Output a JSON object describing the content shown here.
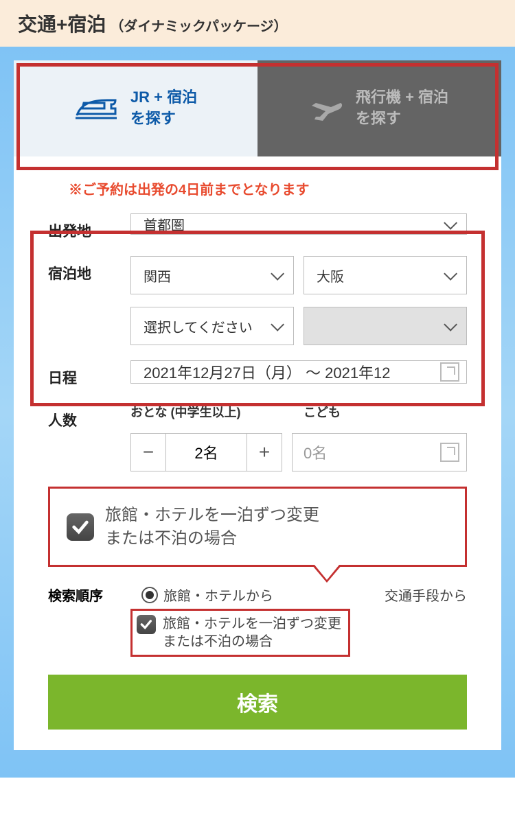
{
  "header": {
    "title": "交通+宿泊",
    "subtitle": "（ダイナミックパッケージ）"
  },
  "tabs": {
    "jr": {
      "line1": "JR + 宿泊",
      "line2": "を探す"
    },
    "plane": {
      "line1": "飛行機 + 宿泊",
      "line2": "を探す"
    }
  },
  "notice": "※ご予約は出発の4日前までとなります",
  "labels": {
    "departure": "出発地",
    "stay": "宿泊地",
    "dates": "日程",
    "people": "人数",
    "adult": "おとな (中学生以上)",
    "child": "こども",
    "order": "検索順序"
  },
  "fields": {
    "departure": "首都圏",
    "stay_region": "関西",
    "stay_pref": "大阪",
    "stay_area": "選択してください",
    "date_range": "2021年12月27日（月） ～ 2021年12",
    "adults": "2名",
    "children_placeholder": "0名"
  },
  "callout": {
    "line1": "旅館・ホテルを一泊ずつ変更",
    "line2": "または不泊の場合"
  },
  "order": {
    "opt1": "旅館・ホテルから",
    "opt2": "交通手段から"
  },
  "check": {
    "line1": "旅館・ホテルを一泊ずつ変更",
    "line2": "または不泊の場合"
  },
  "search": "検索"
}
